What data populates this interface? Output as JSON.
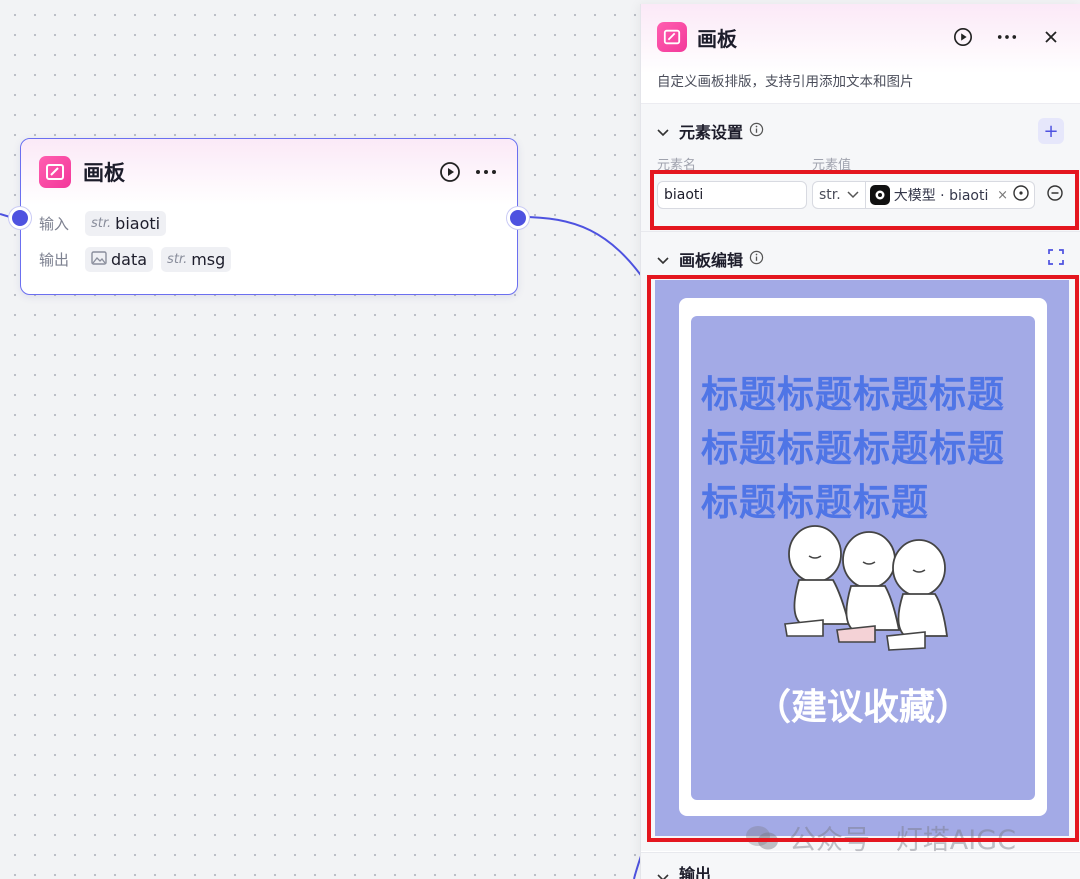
{
  "node": {
    "title": "画板",
    "input_label": "输入",
    "input_var": {
      "type": "str.",
      "name": "biaoti"
    },
    "output_label": "输出",
    "outputs": [
      {
        "type": "image",
        "name": "data"
      },
      {
        "type": "str.",
        "name": "msg"
      }
    ]
  },
  "panel": {
    "title": "画板",
    "description": "自定义画板排版，支持引用添加文本和图片",
    "element_section": {
      "title": "元素设置",
      "col_name": "元素名",
      "col_value": "元素值",
      "row": {
        "name_value": "biaoti",
        "type": "str.",
        "ref_text": "大模型 · biaoti"
      }
    },
    "editor_section": {
      "title": "画板编辑"
    },
    "output_section": {
      "title": "输出"
    }
  },
  "canvas_card": {
    "title": "标题标题标题标题标题标题标题标题标题标题标题",
    "subtitle": "（建议收藏）"
  },
  "watermark": "公众号 · 灯塔AIGC",
  "colors": {
    "accent": "#4e52e0",
    "brand_pink": "#f3389a",
    "highlight_red": "#e4161f",
    "card_bg": "#a3aae6",
    "card_title": "#4f75e6"
  }
}
